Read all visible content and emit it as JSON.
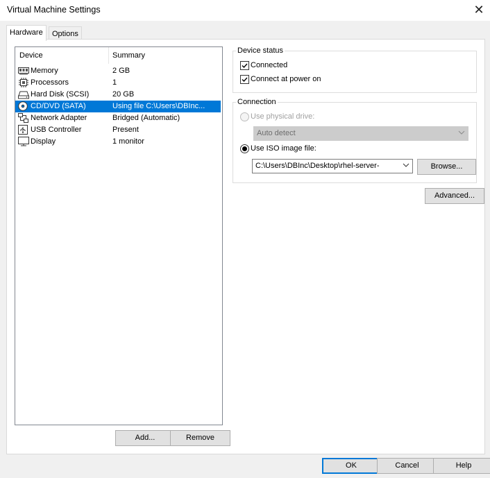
{
  "window": {
    "title": "Virtual Machine Settings"
  },
  "tabs": [
    {
      "label": "Hardware",
      "active": true
    },
    {
      "label": "Options",
      "active": false
    }
  ],
  "device_list": {
    "columns": [
      "Device",
      "Summary"
    ],
    "rows": [
      {
        "device": "Memory",
        "summary": "2 GB",
        "icon": "memory-icon"
      },
      {
        "device": "Processors",
        "summary": "1",
        "icon": "processor-icon"
      },
      {
        "device": "Hard Disk (SCSI)",
        "summary": "20 GB",
        "icon": "hard-disk-icon"
      },
      {
        "device": "CD/DVD (SATA)",
        "summary": "Using file C:\\Users\\DBInc...",
        "icon": "cd-dvd-icon",
        "selected": true
      },
      {
        "device": "Network Adapter",
        "summary": "Bridged (Automatic)",
        "icon": "network-adapter-icon"
      },
      {
        "device": "USB Controller",
        "summary": "Present",
        "icon": "usb-icon"
      },
      {
        "device": "Display",
        "summary": "1 monitor",
        "icon": "display-icon"
      }
    ]
  },
  "list_buttons": {
    "add": "Add...",
    "remove": "Remove"
  },
  "device_status": {
    "label": "Device status",
    "connected": {
      "label": "Connected",
      "checked": true
    },
    "connect_power_on": {
      "label": "Connect at power on",
      "checked": true
    }
  },
  "connection": {
    "label": "Connection",
    "physical": {
      "label": "Use physical drive:",
      "selected": false,
      "disabled": true
    },
    "auto_detect": "Auto detect",
    "iso": {
      "label": "Use ISO image file:",
      "selected": true
    },
    "iso_path": "C:\\Users\\DBInc\\Desktop\\rhel-server-",
    "browse": "Browse..."
  },
  "advanced": "Advanced...",
  "footer": {
    "ok": "OK",
    "cancel": "Cancel",
    "help": "Help"
  },
  "colors": {
    "selection": "#0078d7",
    "dialog_bg": "#f0f0f0"
  }
}
